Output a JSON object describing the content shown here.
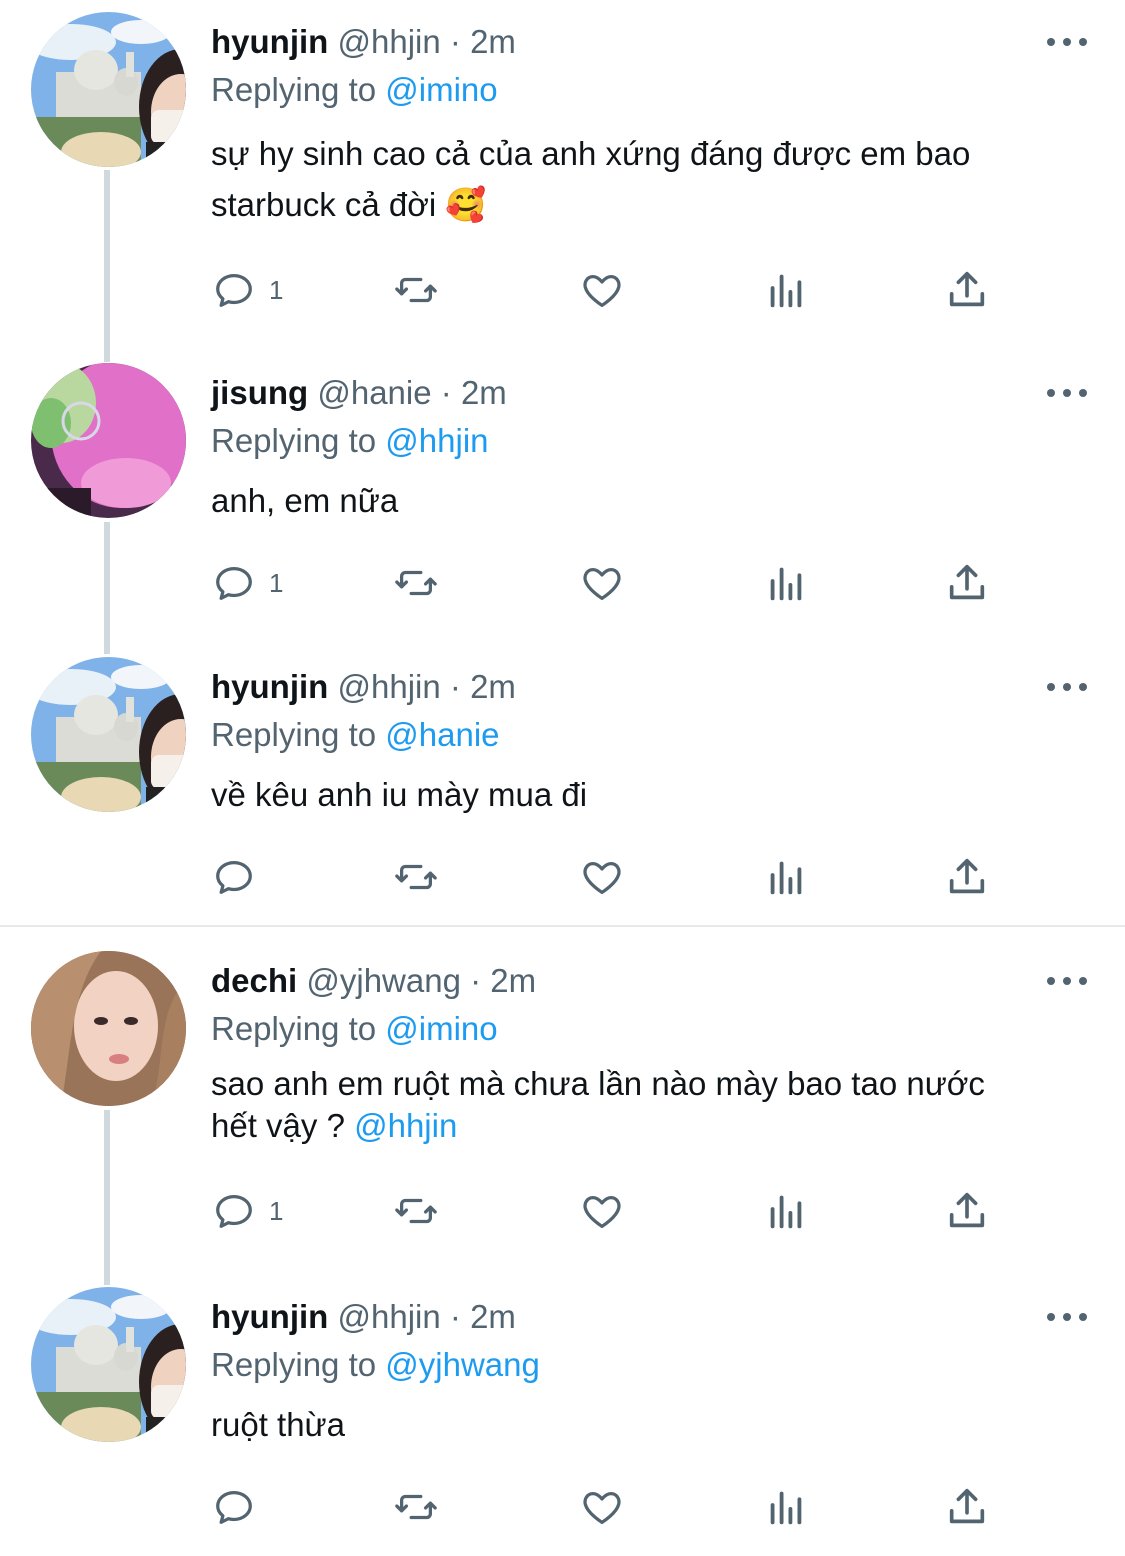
{
  "tweets": [
    {
      "name": "hyunjin",
      "handle": "@hhjin",
      "dot": "·",
      "time": "2m",
      "replying_prefix": "Replying to",
      "replying_to": "@imino",
      "text_line1": "sự hy sinh cao cả của anh xứng đáng được em bao",
      "text_line2": "starbuck cả đời 🥰",
      "reply_count": "1",
      "avatar": "hyunjin-avatar"
    },
    {
      "name": "jisung",
      "handle": "@hanie",
      "dot": "·",
      "time": "2m",
      "replying_prefix": "Replying to",
      "replying_to": "@hhjin",
      "text_line1": "anh, em nữa",
      "reply_count": "1",
      "avatar": "jisung-avatar"
    },
    {
      "name": "hyunjin",
      "handle": "@hhjin",
      "dot": "·",
      "time": "2m",
      "replying_prefix": "Replying to",
      "replying_to": "@hanie",
      "text_line1": "về kêu anh iu mày mua đi",
      "reply_count": "",
      "avatar": "hyunjin-avatar"
    },
    {
      "name": "dechi",
      "handle": "@yjhwang",
      "dot": "·",
      "time": "2m",
      "replying_prefix": "Replying to",
      "replying_to": "@imino",
      "text_line1": "sao anh em ruột mà chưa lần nào mày bao tao nước",
      "text_line2_plain": "hết vậy ? ",
      "text_line2_mention": "@hhjin",
      "reply_count": "1",
      "avatar": "dechi-avatar"
    },
    {
      "name": "hyunjin",
      "handle": "@hhjin",
      "dot": "·",
      "time": "2m",
      "replying_prefix": "Replying to",
      "replying_to": "@yjhwang",
      "text_line1": "ruột thừa",
      "reply_count": "",
      "avatar": "hyunjin-avatar"
    }
  ],
  "colors": {
    "link": "#1d9bf0",
    "secondary": "#536471",
    "thread_line": "#cfd9de",
    "separator": "#e7e9ea"
  },
  "icons": [
    "reply-icon",
    "retweet-icon",
    "like-icon",
    "views-icon",
    "share-icon",
    "more-icon"
  ]
}
